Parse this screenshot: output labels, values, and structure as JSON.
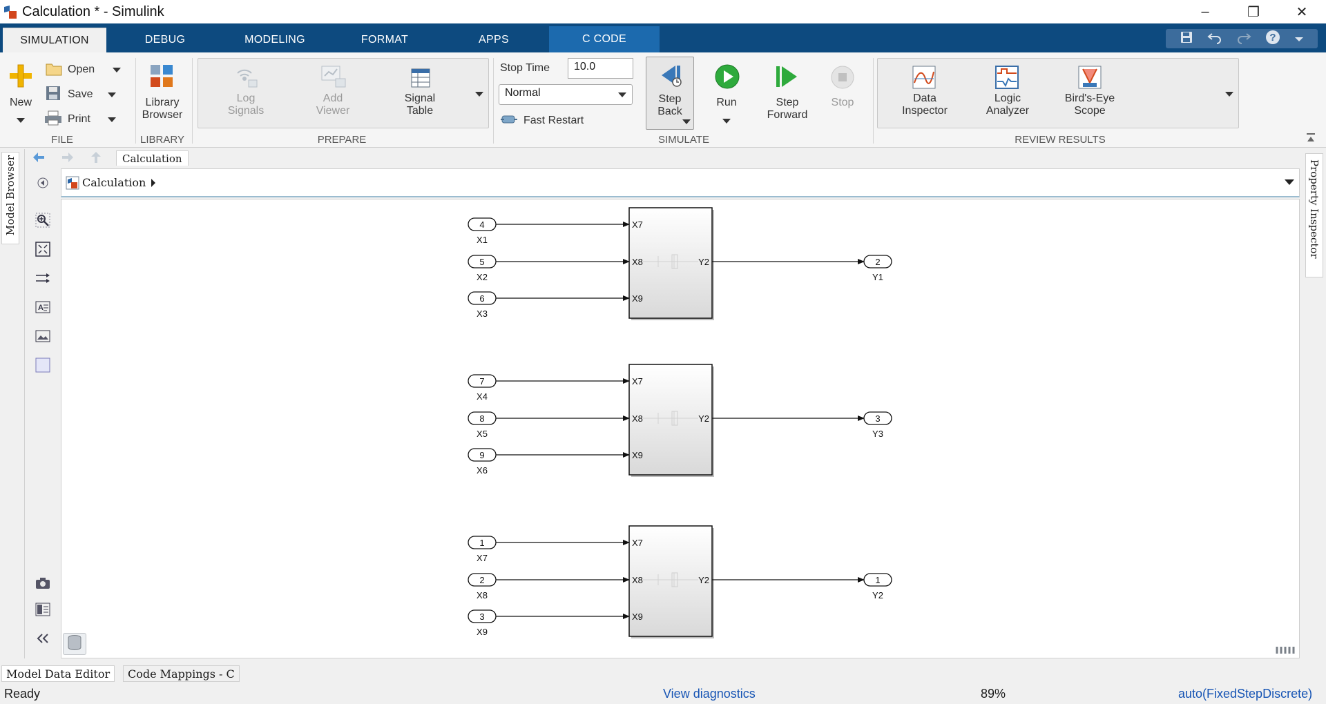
{
  "window": {
    "title": "Calculation * - Simulink",
    "minimize": "–",
    "restore": "❐",
    "close": "✕"
  },
  "tabs": [
    {
      "label": "SIMULATION"
    },
    {
      "label": "DEBUG"
    },
    {
      "label": "MODELING"
    },
    {
      "label": "FORMAT"
    },
    {
      "label": "APPS"
    },
    {
      "label": "C CODE"
    }
  ],
  "ribbon": {
    "file": {
      "section": "FILE",
      "new": "New",
      "open": "Open",
      "save": "Save",
      "print": "Print"
    },
    "library": {
      "section": "LIBRARY",
      "line1": "Library",
      "line2": "Browser"
    },
    "prepare": {
      "section": "PREPARE",
      "log1": "Log",
      "log2": "Signals",
      "add1": "Add",
      "add2": "Viewer",
      "sig1": "Signal",
      "sig2": "Table"
    },
    "simulate": {
      "section": "SIMULATE",
      "stop_time_label": "Stop Time",
      "stop_time_value": "10.0",
      "mode": "Normal",
      "fast_restart": "Fast Restart",
      "step_back1": "Step",
      "step_back2": "Back",
      "run": "Run",
      "step_fwd1": "Step",
      "step_fwd2": "Forward",
      "stop": "Stop"
    },
    "review": {
      "section": "REVIEW RESULTS",
      "data1": "Data",
      "data2": "Inspector",
      "logic1": "Logic",
      "logic2": "Analyzer",
      "birds1": "Bird's-Eye",
      "birds2": "Scope"
    }
  },
  "nav": {
    "tab": "Calculation",
    "breadcrumb": "Calculation"
  },
  "docks": {
    "left": "Model Browser",
    "right": "Property Inspector"
  },
  "diagram": {
    "subsystems": [
      {
        "inputs": [
          {
            "num": "4",
            "name": "X1"
          },
          {
            "num": "5",
            "name": "X2"
          },
          {
            "num": "6",
            "name": "X3"
          }
        ],
        "in_ports": [
          "X7",
          "X8",
          "X9"
        ],
        "out_port": "Y2",
        "output": {
          "num": "2",
          "name": "Y1"
        }
      },
      {
        "inputs": [
          {
            "num": "7",
            "name": "X4"
          },
          {
            "num": "8",
            "name": "X5"
          },
          {
            "num": "9",
            "name": "X6"
          }
        ],
        "in_ports": [
          "X7",
          "X8",
          "X9"
        ],
        "out_port": "Y2",
        "output": {
          "num": "3",
          "name": "Y3"
        }
      },
      {
        "inputs": [
          {
            "num": "1",
            "name": "X7"
          },
          {
            "num": "2",
            "name": "X8"
          },
          {
            "num": "3",
            "name": "X9"
          }
        ],
        "in_ports": [
          "X7",
          "X8",
          "X9"
        ],
        "out_port": "Y2",
        "output": {
          "num": "1",
          "name": "Y2"
        }
      }
    ]
  },
  "bottom_tabs": [
    "Model Data Editor",
    "Code Mappings - C"
  ],
  "status": {
    "ready": "Ready",
    "diagnostics": "View diagnostics",
    "zoom": "89%",
    "solver": "auto(FixedStepDiscrete)"
  },
  "colors": {
    "tabbar": "#0d4a7f",
    "active_tab_code": "#1c6aae",
    "link": "#1654b4"
  }
}
